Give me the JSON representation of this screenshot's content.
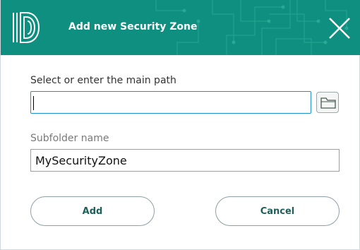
{
  "dialog": {
    "title": "Add new Security Zone",
    "logo_icon": "fingerprint-d-logo",
    "close_icon": "close-icon",
    "accent_color": "#0e8f7f"
  },
  "form": {
    "main_path_label": "Select or enter the main path",
    "main_path_value": "",
    "folder_icon": "folder-icon",
    "subfolder_label": "Subfolder name",
    "subfolder_value": "MySecurityZone"
  },
  "buttons": {
    "add_label": "Add",
    "cancel_label": "Cancel"
  }
}
